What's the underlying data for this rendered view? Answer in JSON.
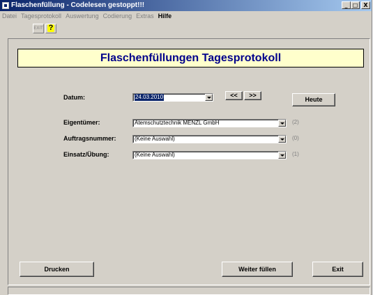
{
  "window": {
    "title": "Flaschenfüllung  -  Codelesen gestoppt!!!",
    "minimize": "_",
    "maximize": "□",
    "close": "X"
  },
  "menu": [
    "Datei",
    "Tagesprotokoll",
    "Auswertung",
    "Codierung",
    "Extras",
    "Hilfe"
  ],
  "toolbar": {
    "exit_label": "EXIT",
    "help_label": "?"
  },
  "header": {
    "title": "Flaschenfüllungen Tagesprotokoll"
  },
  "form": {
    "datum_label": "Datum:",
    "datum_value": "24.03.2010",
    "prev_label": "<<",
    "next_label": ">>",
    "heute_label": "Heute",
    "eigentuemer_label": "Eigentümer:",
    "eigentuemer_value": "Atemschutztechnik MENZL GmbH",
    "eigentuemer_count": "(2)",
    "auftrag_label": "Auftragsnummer:",
    "auftrag_value": "(Keine Auswahl)",
    "auftrag_count": "(0)",
    "einsatz_label": "Einsatz/Übung:",
    "einsatz_value": "(Keine Auswahl)",
    "einsatz_count": "(1)"
  },
  "buttons": {
    "drucken": "Drucken",
    "weiter": "Weiter füllen",
    "exit": "Exit"
  }
}
